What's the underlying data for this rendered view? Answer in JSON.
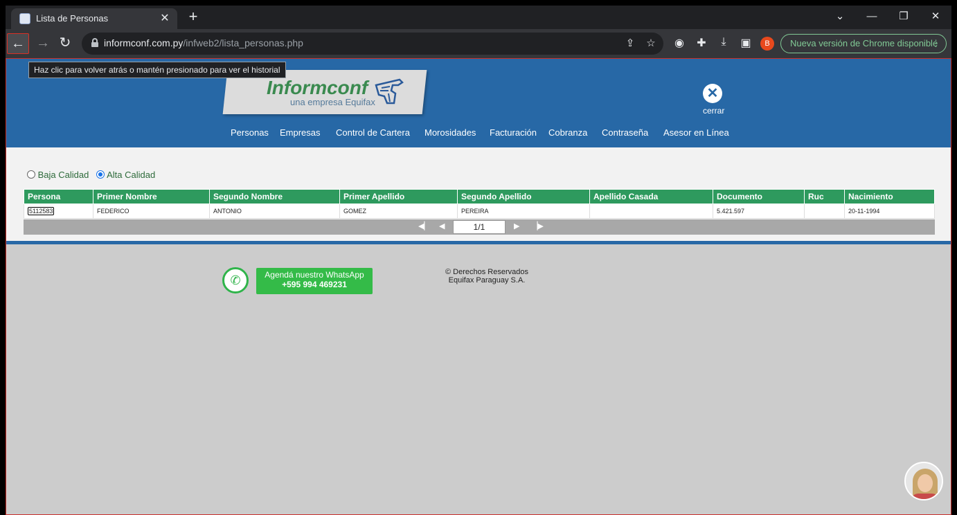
{
  "browser": {
    "tab_title": "Lista de Personas",
    "tab_close": "✕",
    "new_tab": "+",
    "url_host": "informconf.com.py",
    "url_path": "/infweb2/lista_personas.php",
    "profile_initial": "B",
    "update_label": "Nueva versión de Chrome disponible",
    "back_tooltip": "Haz clic para volver atrás o mantén presionado para ver el historial"
  },
  "site": {
    "logo_name": "Informconf",
    "logo_tagline": "una empresa Equifax",
    "close_label": "cerrar",
    "menu": [
      "Personas",
      "Empresas",
      "Control de Cartera",
      "Morosidades",
      "Facturación",
      "Cobranza",
      "Contraseña",
      "Asesor en Línea"
    ]
  },
  "filters": {
    "low_quality": "Baja Calidad",
    "high_quality": "Alta Calidad",
    "selected": "Alta Calidad"
  },
  "table": {
    "headers": [
      "Persona",
      "Primer Nombre",
      "Segundo Nombre",
      "Primer Apellido",
      "Segundo Apellido",
      "Apellido Casada",
      "Documento",
      "Ruc",
      "Nacimiento"
    ],
    "rows": [
      [
        "5112583",
        "FEDERICO",
        "ANTONIO",
        "GOMEZ",
        "PEREIRA",
        "",
        "5.421.597",
        "",
        "20-11-1994"
      ]
    ]
  },
  "pager": {
    "page": "1/1"
  },
  "footer": {
    "whatsapp_line1": "Agendá nuestro WhatsApp",
    "whatsapp_line2": "+595 994 469231",
    "copyright_line1": "© Derechos Reservados",
    "copyright_line2": "Equifax Paraguay S.A."
  },
  "colors": {
    "header_blue": "#2768a6",
    "table_header_green": "#2e9a5e",
    "whatsapp_green": "#34bb48",
    "chrome_update_green": "#81c995"
  }
}
